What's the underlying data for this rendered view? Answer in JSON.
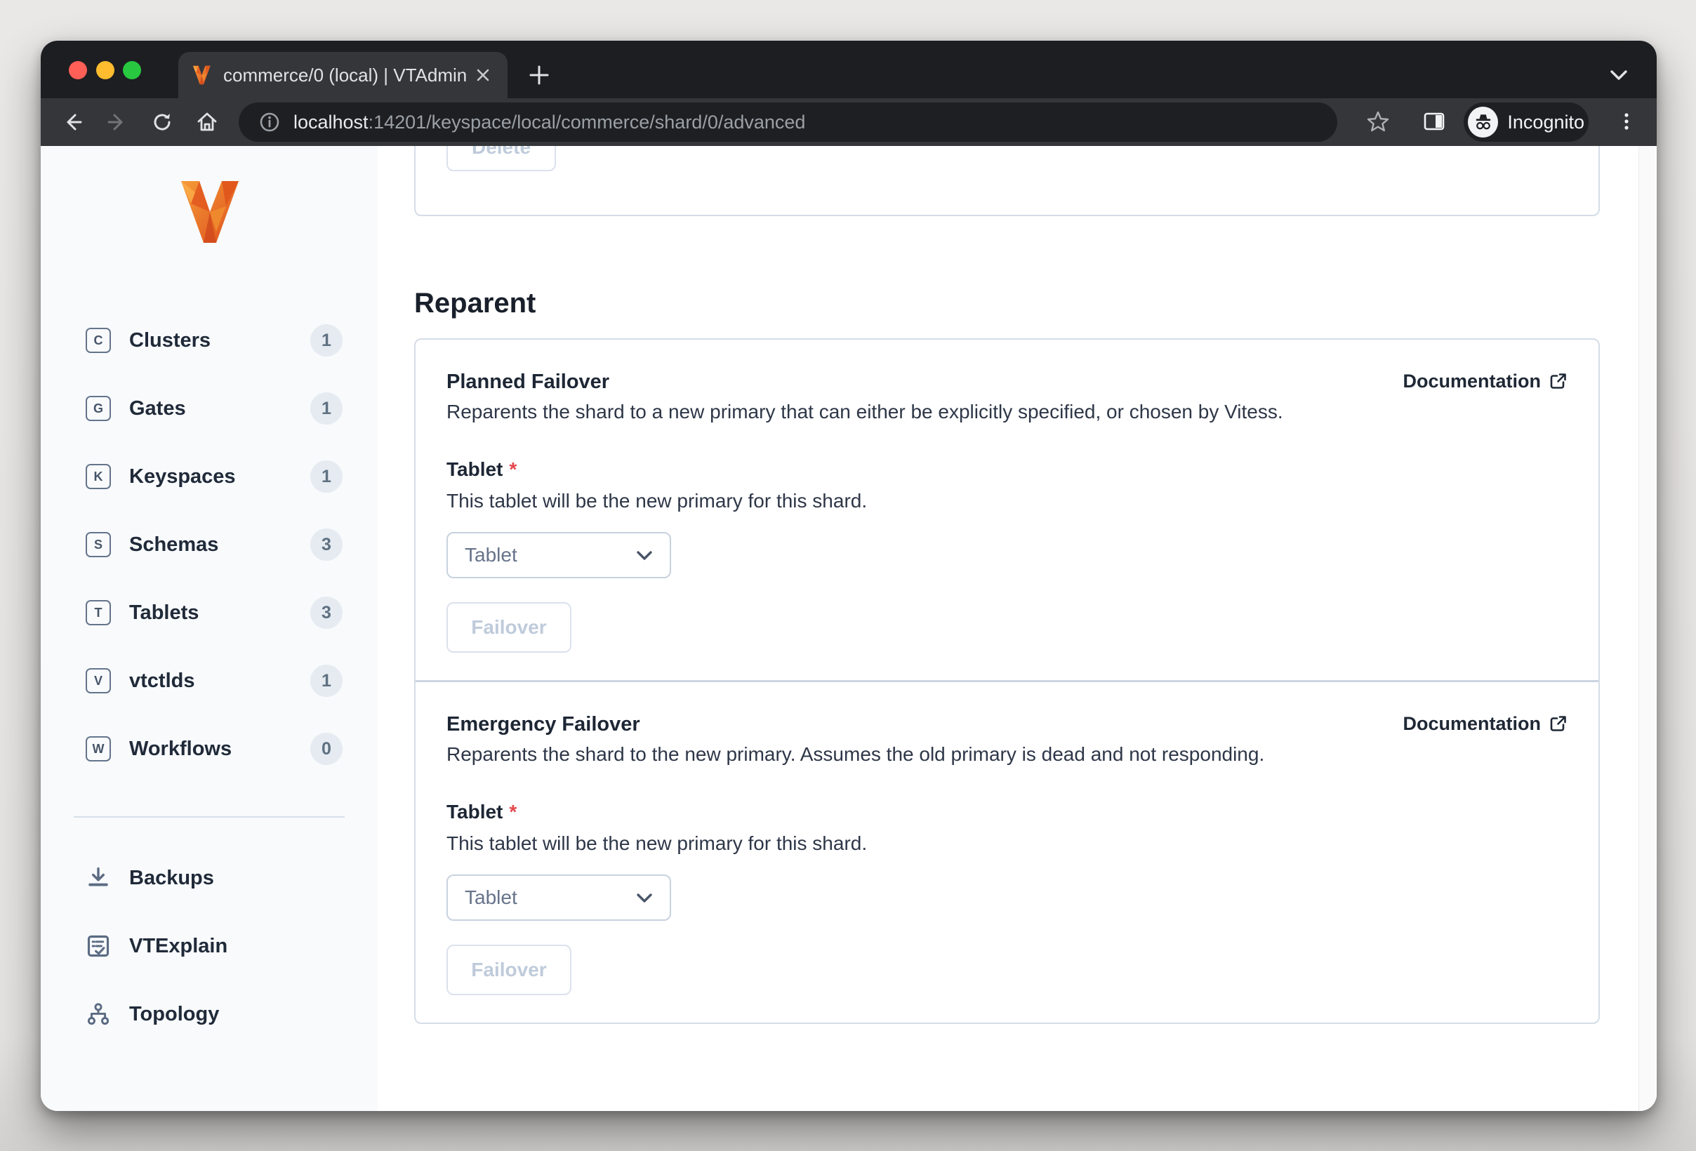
{
  "browser": {
    "tab": {
      "title": "commerce/0 (local) | VTAdmin",
      "favicon": "vitess-v-icon"
    },
    "url": {
      "host": "localhost",
      "rest": ":14201/keyspace/local/commerce/shard/0/advanced"
    },
    "incognito_label": "Incognito"
  },
  "sidebar": {
    "items": [
      {
        "letter": "C",
        "label": "Clusters",
        "count": "1"
      },
      {
        "letter": "G",
        "label": "Gates",
        "count": "1"
      },
      {
        "letter": "K",
        "label": "Keyspaces",
        "count": "1"
      },
      {
        "letter": "S",
        "label": "Schemas",
        "count": "3"
      },
      {
        "letter": "T",
        "label": "Tablets",
        "count": "3"
      },
      {
        "letter": "V",
        "label": "vtctlds",
        "count": "1"
      },
      {
        "letter": "W",
        "label": "Workflows",
        "count": "0"
      }
    ],
    "tools": [
      {
        "icon": "download-icon",
        "label": "Backups"
      },
      {
        "icon": "vtexplain-icon",
        "label": "VTExplain"
      },
      {
        "icon": "topology-icon",
        "label": "Topology"
      }
    ]
  },
  "main": {
    "delete_label": "Delete",
    "heading": "Reparent",
    "sections": [
      {
        "title": "Planned Failover",
        "doc_label": "Documentation",
        "description": "Reparents the shard to a new primary that can either be explicitly specified, or chosen by Vitess.",
        "field_label": "Tablet",
        "required_mark": "*",
        "field_help": "This tablet will be the new primary for this shard.",
        "select_value": "Tablet",
        "button_label": "Failover"
      },
      {
        "title": "Emergency Failover",
        "doc_label": "Documentation",
        "description": "Reparents the shard to the new primary. Assumes the old primary is dead and not responding.",
        "field_label": "Tablet",
        "required_mark": "*",
        "field_help": "This tablet will be the new primary for this shard.",
        "select_value": "Tablet",
        "button_label": "Failover"
      }
    ]
  },
  "colors": {
    "brand_orange": "#f28c2e",
    "brand_orange_dark": "#dd4f1d",
    "slate_icon": "#5b6b82",
    "badge_bg": "#e5ebf1",
    "card_border": "#d5dde7",
    "disabled_text": "#bfcbdb",
    "required_red": "#e5484d",
    "traffic_red": "#ff5f57",
    "traffic_yellow": "#febc2e",
    "traffic_green": "#28c840"
  }
}
